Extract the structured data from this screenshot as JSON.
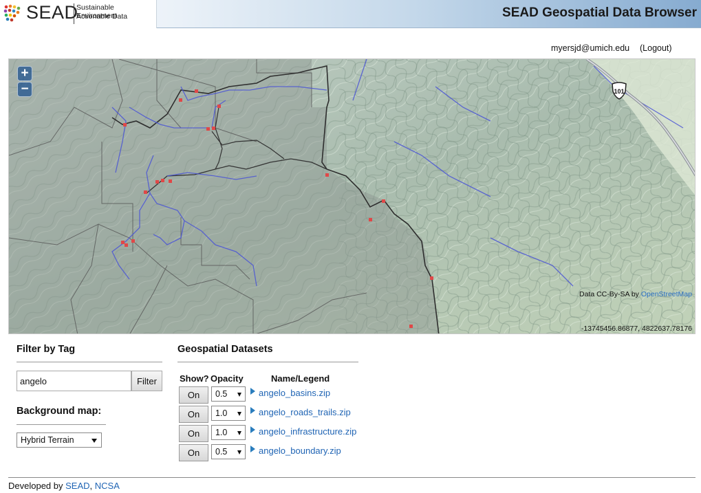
{
  "header": {
    "logo_text": "SEAD",
    "logo_tagline_1": "Sustainable Environment",
    "logo_tagline_2": "Actionable Data",
    "title": "SEAD Geospatial Data Browser"
  },
  "user": {
    "email": "myersjd@umich.edu",
    "logout_label": "(Logout)"
  },
  "map": {
    "zoom_in": "+",
    "zoom_out": "−",
    "attribution_prefix": "Data CC-By-SA by ",
    "attribution_link": "OpenStreetMap",
    "coordinates": "-13745456.86877, 4822637.78176",
    "highway_shield": "101",
    "colors": {
      "boundary": "#333333",
      "streams": "#4b55d6",
      "points": "#e04848"
    }
  },
  "filter": {
    "heading": "Filter by Tag",
    "input_value": "angelo",
    "button_label": "Filter"
  },
  "background_map": {
    "heading": "Background map:",
    "selected": "Hybrid Terrain"
  },
  "datasets": {
    "heading": "Geospatial Datasets",
    "columns": {
      "show": "Show?",
      "opacity": "Opacity",
      "name": "Name/Legend"
    },
    "rows": [
      {
        "toggle": "On",
        "opacity": "0.5",
        "name": "angelo_basins.zip"
      },
      {
        "toggle": "On",
        "opacity": "1.0",
        "name": "angelo_roads_trails.zip"
      },
      {
        "toggle": "On",
        "opacity": "1.0",
        "name": "angelo_infrastructure.zip"
      },
      {
        "toggle": "On",
        "opacity": "0.5",
        "name": "angelo_boundary.zip"
      }
    ]
  },
  "footer": {
    "prefix": "Developed by ",
    "link1": "SEAD",
    "separator": ", ",
    "link2": "NCSA"
  }
}
